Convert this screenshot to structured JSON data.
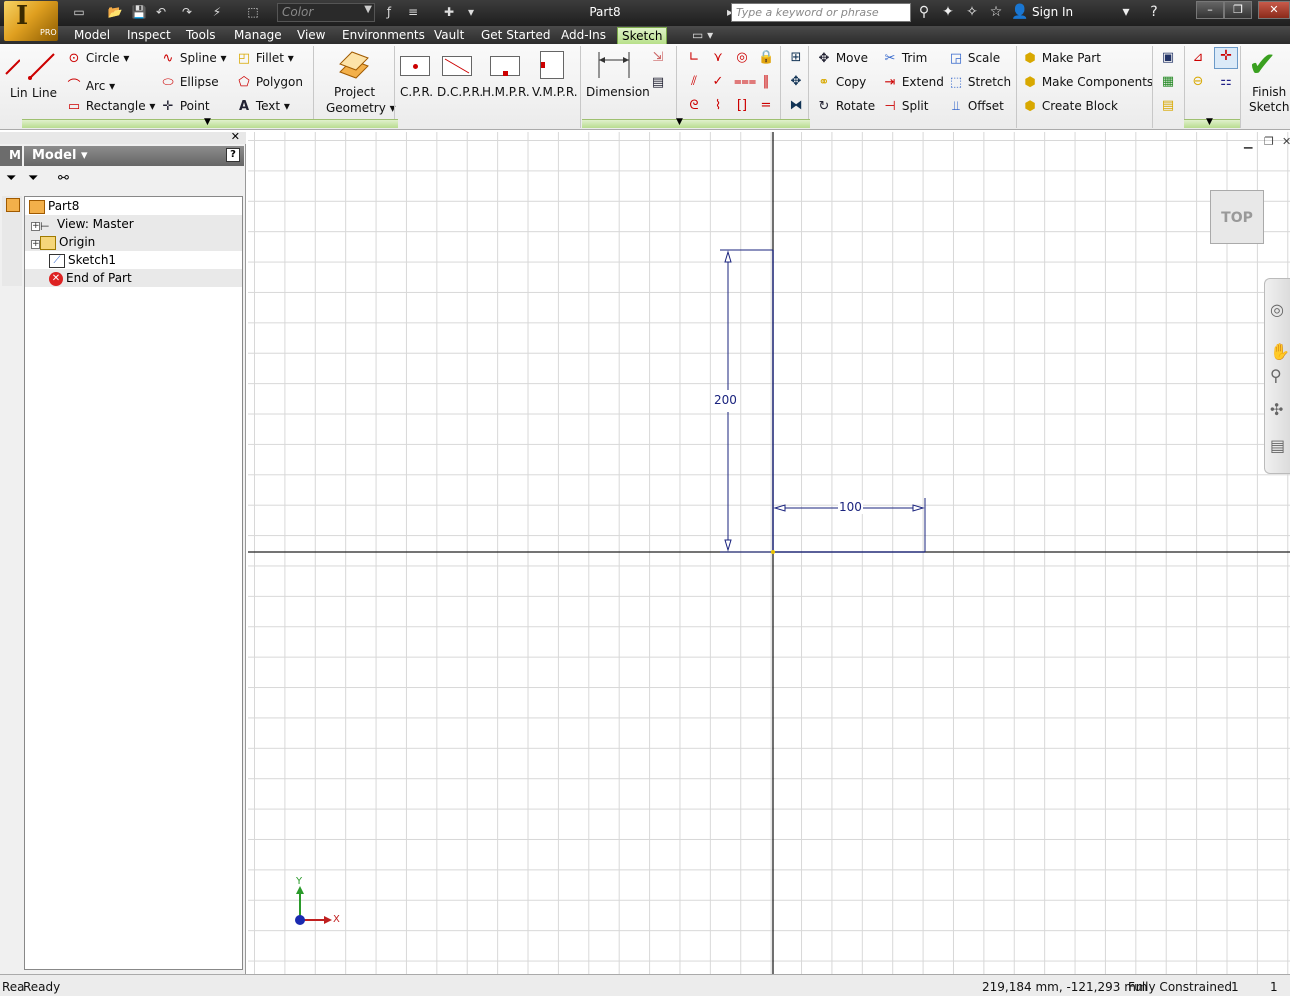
{
  "app": {
    "title": "Part8",
    "logo_letter": "I",
    "edition": "PRO"
  },
  "titlebar": {
    "color_select": "Color",
    "search_placeholder": "Type a keyword or phrase",
    "sign_in": "Sign In"
  },
  "menu": [
    {
      "label": "Model"
    },
    {
      "label": "Inspect"
    },
    {
      "label": "Tools"
    },
    {
      "label": "Manage"
    },
    {
      "label": "View"
    },
    {
      "label": "Environments"
    },
    {
      "label": "Vault"
    },
    {
      "label": "Get Started"
    },
    {
      "label": "Add-Ins"
    },
    {
      "label": "Sketch"
    }
  ],
  "ribbon": {
    "draw": {
      "line_partial": "Lin",
      "line": "Line",
      "circle": "Circle",
      "arc": "Arc",
      "rectangle": "Rectangle",
      "spline": "Spline",
      "ellipse": "Ellipse",
      "point": "Point",
      "fillet": "Fillet",
      "polygon": "Polygon",
      "text": "Text"
    },
    "project_geometry": [
      "Project",
      "Geometry"
    ],
    "custom": [
      "C.P.R.",
      "D.C.P.R.",
      "H.M.P.R.",
      "V.M.P.R."
    ],
    "dimension": "Dimension",
    "modify": {
      "move": "Move",
      "copy": "Copy",
      "rotate": "Rotate",
      "trim": "Trim",
      "extend": "Extend",
      "split": "Split",
      "scale": "Scale",
      "stretch": "Stretch",
      "offset": "Offset"
    },
    "layout": {
      "make_part": "Make Part",
      "make_components": "Make Components",
      "create_block": "Create Block"
    },
    "finish": [
      "Finish",
      "Sketch"
    ]
  },
  "browser": {
    "tab": "M",
    "header": "Model",
    "help": "?",
    "nodes": [
      {
        "label": "Part8"
      },
      {
        "label": "View: Master"
      },
      {
        "label": "Origin"
      },
      {
        "label": "Sketch1"
      },
      {
        "label": "End of Part"
      }
    ]
  },
  "canvas": {
    "viewcube": "TOP",
    "dim_vertical": "200",
    "dim_horizontal": "100",
    "axis_y": "Y",
    "axis_x": "X"
  },
  "status": {
    "prefix": "Rea",
    "text": "Ready",
    "coords": "219,184 mm, -121,293 mm",
    "constraint": "Fully Constrained",
    "count1": "1",
    "count2": "1"
  },
  "colors": {
    "accent_green": "#b8e08a",
    "sketch_blue": "#1a237e",
    "finish_green": "#3aa020"
  }
}
